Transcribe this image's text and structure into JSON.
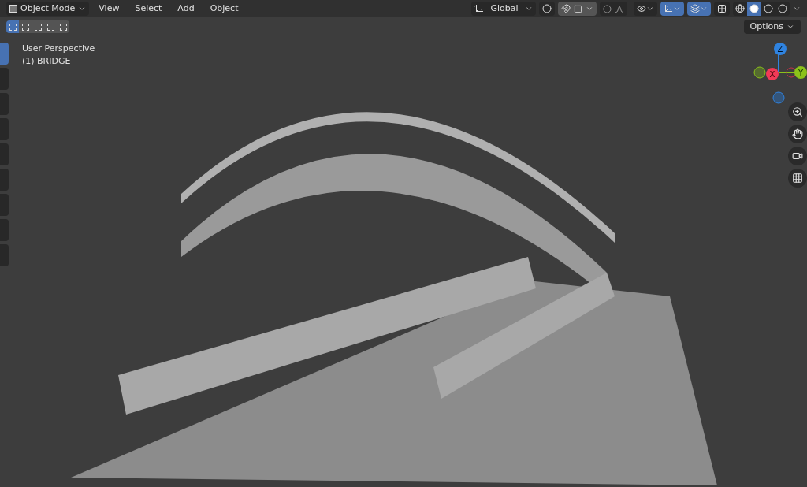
{
  "header": {
    "mode": "Object Mode",
    "menus": [
      "View",
      "Select",
      "Add",
      "Object"
    ],
    "orientation": "Global",
    "gizmo_on": true,
    "overlays_on": true,
    "xray_on": false,
    "shading": [
      {
        "selected": false
      },
      {
        "selected": true
      },
      {
        "selected": false
      },
      {
        "selected": false
      }
    ]
  },
  "select_modes": [
    {
      "selected": true
    },
    {
      "selected": false
    },
    {
      "selected": false
    },
    {
      "selected": false
    },
    {
      "selected": false
    }
  ],
  "options": "Options",
  "overlay_text": [
    "User Perspective",
    "(1) BRIDGE"
  ],
  "toolbar": [
    {
      "selected": true
    },
    {
      "selected": false
    },
    {
      "selected": false
    },
    {
      "selected": false
    },
    {
      "selected": false
    },
    {
      "selected": false
    },
    {
      "selected": false
    },
    {
      "selected": false
    },
    {
      "selected": false
    }
  ],
  "gizmo": {
    "axes": [
      "X",
      "Y",
      "Z"
    ]
  }
}
